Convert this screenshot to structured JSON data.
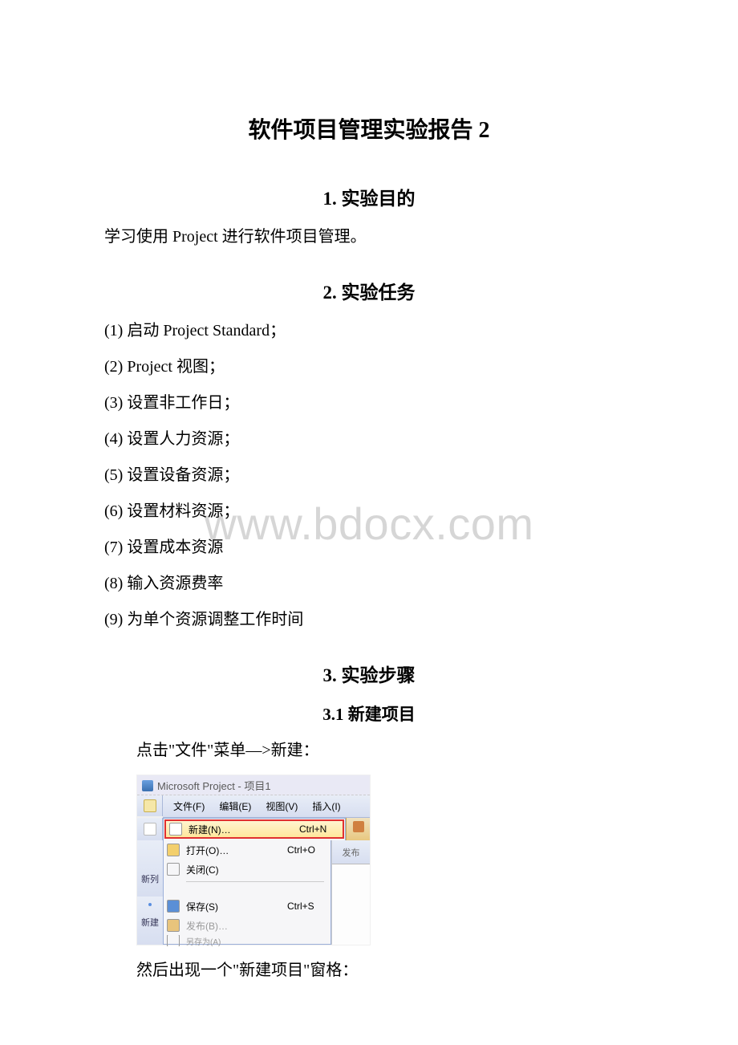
{
  "title": "软件项目管理实验报告 2",
  "watermark": "www.bdocx.com",
  "sections": {
    "s1": {
      "heading": "1. 实验目的",
      "body": "学习使用 Project 进行软件项目管理。"
    },
    "s2": {
      "heading": "2. 实验任务",
      "items": [
        "(1) 启动 Project Standard；",
        "(2) Project 视图；",
        "(3) 设置非工作日；",
        "(4) 设置人力资源；",
        "(5) 设置设备资源；",
        "(6) 设置材料资源；",
        "(7) 设置成本资源",
        "(8) 输入资源费率",
        "(9) 为单个资源调整工作时间"
      ]
    },
    "s3": {
      "heading": "3. 实验步骤",
      "sub1_heading": "3.1 新建项目",
      "line1": "点击\"文件\"菜单—>新建：",
      "line2": "然后出现一个\"新建项目\"窗格："
    }
  },
  "screenshot": {
    "title_text": "Microsoft Project - 项目1",
    "menubar": {
      "file": "文件(F)",
      "edit": "编辑(E)",
      "view": "视图(V)",
      "insert": "插入(I)"
    },
    "menu": {
      "new_label": "新建(N)…",
      "new_shortcut": "Ctrl+N",
      "open_label": "打开(O)…",
      "open_shortcut": "Ctrl+O",
      "close_label": "关闭(C)",
      "save_label": "保存(S)",
      "save_shortcut": "Ctrl+S",
      "publish_label": "发布(B)…",
      "saveas_label": "另存为(A)"
    },
    "side_labels": {
      "new_short": "新列",
      "new_btn": "新建",
      "publish_tab": "发布"
    }
  }
}
